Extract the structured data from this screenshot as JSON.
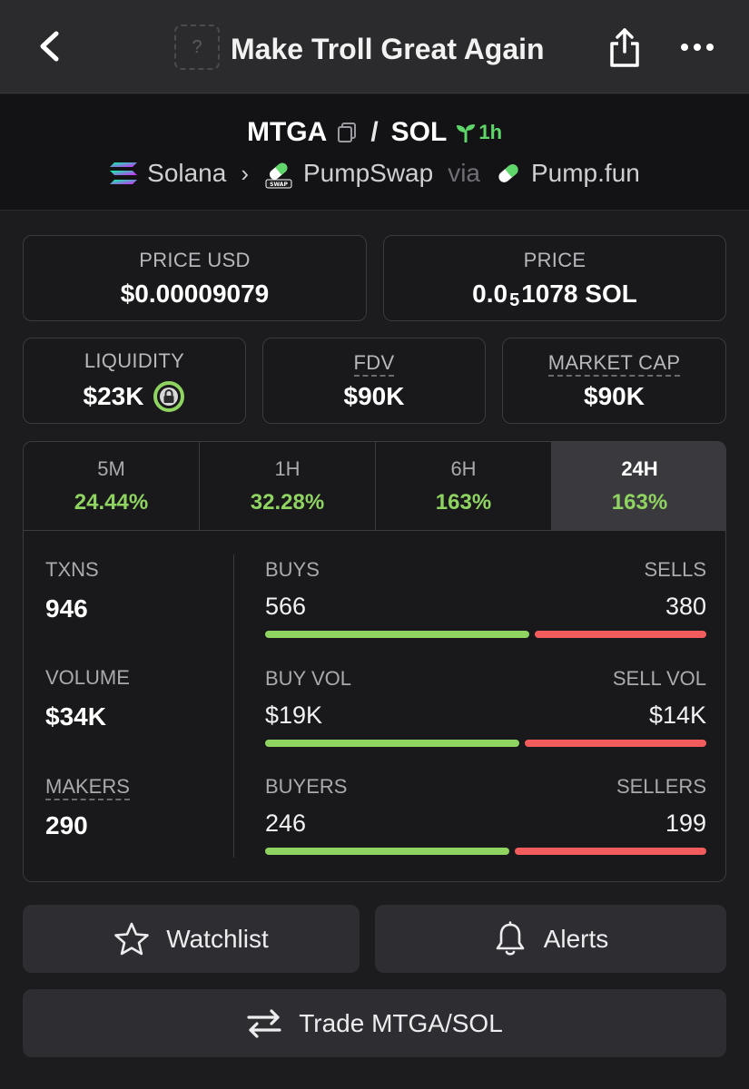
{
  "header": {
    "title": "Make Troll Great Again",
    "logo_placeholder": "?"
  },
  "pair": {
    "base": "MTGA",
    "separator": "/",
    "quote": "SOL",
    "age": "1h",
    "chain": "Solana",
    "dex": "PumpSwap",
    "via": "via",
    "launchpad": "Pump.fun"
  },
  "prices": {
    "price_usd_label": "PRICE USD",
    "price_usd": "$0.00009079",
    "price_label": "PRICE",
    "price_prefix": "0.0",
    "price_zeros": "5",
    "price_suffix": "1078 SOL"
  },
  "metrics": {
    "liquidity_label": "LIQUIDITY",
    "liquidity": "$23K",
    "fdv_label": "FDV",
    "fdv": "$90K",
    "mcap_label": "MARKET CAP",
    "mcap": "$90K"
  },
  "tabs": [
    {
      "label": "5M",
      "value": "24.44%"
    },
    {
      "label": "1H",
      "value": "32.28%"
    },
    {
      "label": "6H",
      "value": "163%"
    },
    {
      "label": "24H",
      "value": "163%"
    }
  ],
  "stats": {
    "txns_label": "TXNS",
    "txns": "946",
    "volume_label": "VOLUME",
    "volume": "$34K",
    "makers_label": "MAKERS",
    "makers": "290",
    "buys_label": "BUYS",
    "buys": "566",
    "sells_label": "SELLS",
    "sells": "380",
    "buys_fraction": 0.598,
    "buy_vol_label": "BUY VOL",
    "buy_vol": "$19K",
    "sell_vol_label": "SELL VOL",
    "sell_vol": "$14K",
    "buy_vol_fraction": 0.576,
    "buyers_label": "BUYERS",
    "buyers": "246",
    "sellers_label": "SELLERS",
    "sellers": "199",
    "buyers_fraction": 0.553
  },
  "actions": {
    "watchlist": "Watchlist",
    "alerts": "Alerts",
    "trade": "Trade MTGA/SOL"
  },
  "colors": {
    "positive": "#8fd461",
    "negative": "#f25c5c",
    "age_green": "#5fd66a"
  }
}
